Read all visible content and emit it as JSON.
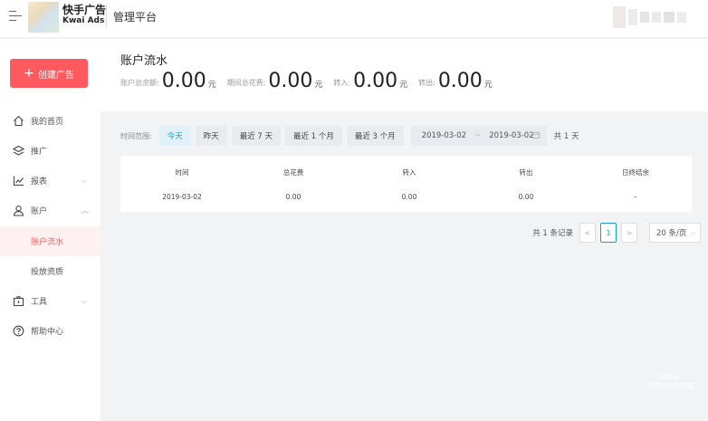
{
  "header": {
    "brand_cn": "快手广告",
    "brand_en": "Kwai Ads",
    "platform": "管理平台"
  },
  "sidebar": {
    "create_label": "创建广告",
    "items": [
      {
        "label": "我的首页",
        "icon": "home-icon"
      },
      {
        "label": "推广",
        "icon": "layers-icon"
      },
      {
        "label": "报表",
        "icon": "chart-line-icon"
      },
      {
        "label": "账户",
        "icon": "user-icon"
      },
      {
        "label": "账户流水",
        "icon": ""
      },
      {
        "label": "投放资质",
        "icon": ""
      },
      {
        "label": "工具",
        "icon": "toolbox-icon"
      },
      {
        "label": "帮助中心",
        "icon": "help-icon"
      }
    ],
    "accent": "#ff5a5f"
  },
  "summary": {
    "title": "账户流水",
    "balance_label": "账户总余额:",
    "balance_value": "0.00",
    "spend_label": "期间总花费:",
    "spend_value": "0.00",
    "in_label": "转入:",
    "in_value": "0.00",
    "out_label": "转出:",
    "out_value": "0.00",
    "unit": "元"
  },
  "filter": {
    "label": "时间范围:",
    "chips": [
      "今天",
      "昨天",
      "最近 7 天",
      "最近 1 个月",
      "最近 3 个月"
    ],
    "active_chip": 0,
    "start_date": "2019-03-02",
    "separator": "~",
    "end_date": "2019-03-02",
    "days": "共 1 天",
    "accent": "#1a9cc6"
  },
  "table": {
    "columns": [
      "时间",
      "总花费",
      "转入",
      "转出",
      "日终结余"
    ],
    "rows": [
      [
        "2019-03-02",
        "0.00",
        "0.00",
        "0.00",
        "–"
      ]
    ]
  },
  "pagination": {
    "total": "共 1 条记录",
    "prev": "<",
    "current": "1",
    "next": ">",
    "page_size": "20 条/页"
  }
}
